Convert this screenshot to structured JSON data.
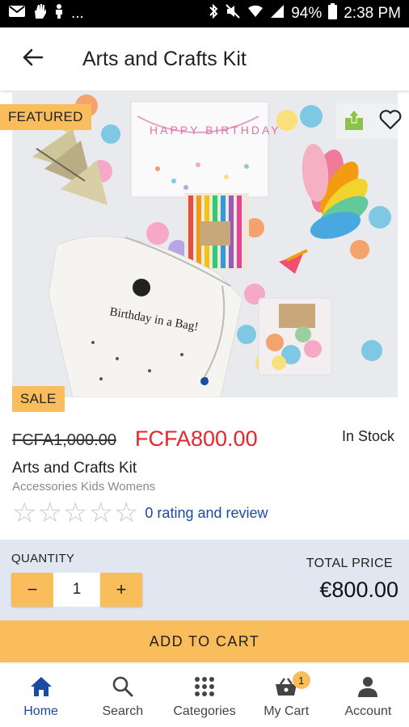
{
  "status_bar": {
    "left_icons": [
      "mail-icon",
      "hand-icon",
      "figure-icon"
    ],
    "ellipsis": "...",
    "battery": "94%",
    "time": "2:38 PM"
  },
  "header": {
    "title": "Arts and Crafts Kit"
  },
  "product": {
    "featured_badge": "FEATURED",
    "sale_badge": "SALE",
    "old_price": "FCFA1,000.00",
    "new_price": "FCFA800.00",
    "stock": "In Stock",
    "name": "Arts and Crafts Kit",
    "categories": "Accessories Kids Womens",
    "rating_value": 0,
    "rating_max": 5,
    "rating_text": "0 rating and review",
    "image_text": {
      "banner": "HAPPY BIRTHDAY",
      "bag": "Birthday in a Bag!"
    }
  },
  "quantity": {
    "label": "QUANTITY",
    "value": "1",
    "minus": "−",
    "plus": "+"
  },
  "total": {
    "label": "TOTAL PRICE",
    "value": "€800.00"
  },
  "add_to_cart": "ADD TO CART",
  "bottom_nav": {
    "items": [
      {
        "label": "Home",
        "icon": "home-icon",
        "active": true
      },
      {
        "label": "Search",
        "icon": "search-icon",
        "active": false
      },
      {
        "label": "Categories",
        "icon": "grid-icon",
        "active": false
      },
      {
        "label": "My Cart",
        "icon": "cart-icon",
        "active": false
      },
      {
        "label": "Account",
        "icon": "account-icon",
        "active": false
      }
    ],
    "cart_count": "1"
  },
  "colors": {
    "accent": "#f9bd5c",
    "sale_price": "#e8242b",
    "link": "#1b4aa3",
    "panel": "#e1e7f1",
    "share_green": "#8bc34a"
  }
}
